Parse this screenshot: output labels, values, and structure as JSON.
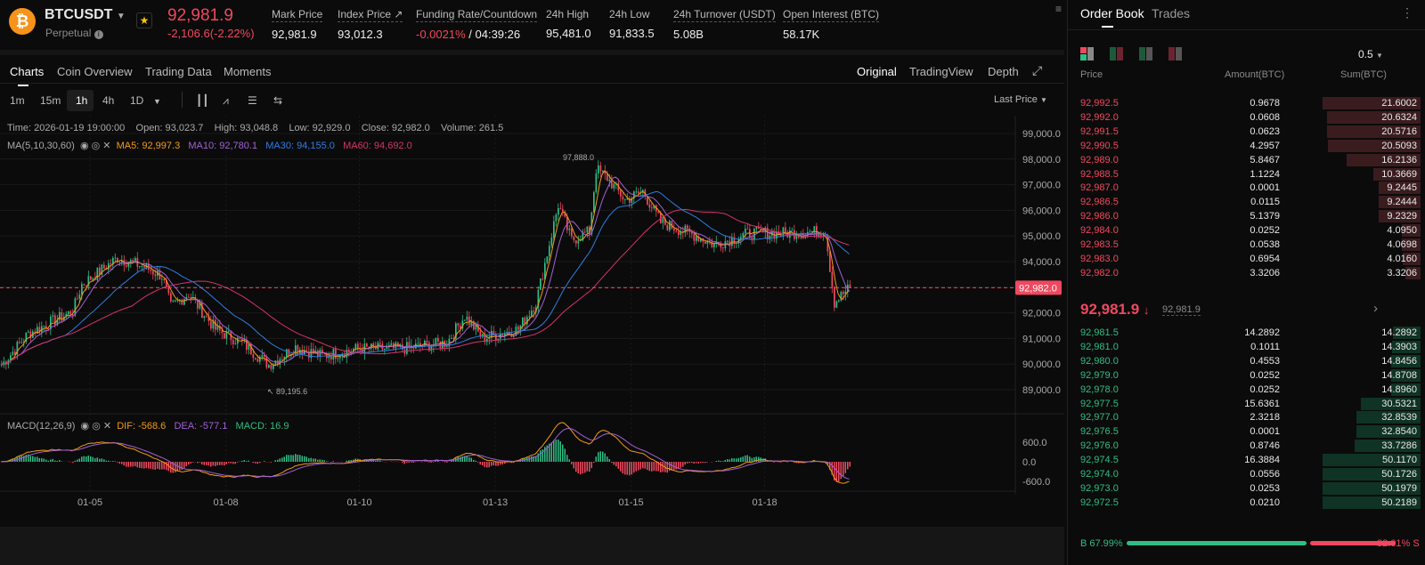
{
  "header": {
    "symbol": "BTCUSDT",
    "type": "Perpetual",
    "last_price": "92,981.9",
    "change": "-2,106.6(-2.22%)",
    "stats": [
      {
        "label": "Mark Price",
        "value": "92,981.9"
      },
      {
        "label": "Index Price ↗",
        "value": "93,012.3"
      },
      {
        "label": "Funding Rate/Countdown",
        "value": "-0.0021%",
        "value2": " / 04:39:26"
      },
      {
        "label": "24h High",
        "value": "95,481.0"
      },
      {
        "label": "24h Low",
        "value": "91,833.5"
      },
      {
        "label": "24h Turnover (USDT)",
        "value": "5.08B"
      },
      {
        "label": "Open Interest (BTC)",
        "value": "58.17K"
      }
    ]
  },
  "tabs": [
    "Charts",
    "Coin Overview",
    "Trading Data",
    "Moments"
  ],
  "chart_modes": [
    "Original",
    "TradingView",
    "Depth"
  ],
  "intervals": [
    "1m",
    "15m",
    "1h",
    "4h",
    "1D"
  ],
  "price_type": "Last Price",
  "ohlc": "Time: 2026-01-19 19:00:00    Open: 93,023.7    High: 93,048.8    Low: 92,929.0    Close: 92,982.0    Volume: 261.5",
  "ma": {
    "label": "MA(5,10,30,60)",
    "ma5": "MA5: 92,997.3",
    "ma10": "MA10: 92,780.1",
    "ma30": "MA30: 94,155.0",
    "ma60": "MA60: 94,692.0"
  },
  "macd": {
    "label": "MACD(12,26,9)",
    "dif": "DIF: -568.6",
    "dea": "DEA: -577.1",
    "macd": "MACD: 16.9"
  },
  "colors": {
    "up": "#2fbd85",
    "down": "#f0485f",
    "ma5": "#f39c12",
    "ma10": "#a260d6",
    "ma30": "#2f7de1",
    "ma60": "#d6336c"
  },
  "chart_data": {
    "type": "candlestick",
    "y_ticks": [
      "99,000.0",
      "98,000.0",
      "97,000.0",
      "96,000.0",
      "95,000.0",
      "94,000.0",
      "93,000.0",
      "92,000.0",
      "91,000.0",
      "90,000.0",
      "89,000.0"
    ],
    "ylim": [
      89000,
      99000
    ],
    "current_price_label": "92,982.0",
    "current_price": 92982,
    "high_annotation": "97,888.0",
    "low_annotation": "89,195.6",
    "x_labels": [
      {
        "label": "01-05",
        "i": 40
      },
      {
        "label": "01-08",
        "i": 101
      },
      {
        "label": "01-10",
        "i": 161
      },
      {
        "label": "01-13",
        "i": 222
      },
      {
        "label": "01-15",
        "i": 283
      },
      {
        "label": "01-18",
        "i": 343
      }
    ],
    "candles": 382,
    "path": [
      [
        0,
        89970
      ],
      [
        12,
        91190
      ],
      [
        32,
        92060
      ],
      [
        36,
        93100
      ],
      [
        52,
        94140
      ],
      [
        64,
        93800
      ],
      [
        72,
        93440
      ],
      [
        76,
        92230
      ],
      [
        84,
        92750
      ],
      [
        96,
        91360
      ],
      [
        108,
        90840
      ],
      [
        120,
        89970
      ],
      [
        132,
        90670
      ],
      [
        144,
        90320
      ],
      [
        160,
        90600
      ],
      [
        180,
        90600
      ],
      [
        200,
        90840
      ],
      [
        208,
        91880
      ],
      [
        216,
        91010
      ],
      [
        232,
        91360
      ],
      [
        240,
        92400
      ],
      [
        250,
        96220
      ],
      [
        256,
        94830
      ],
      [
        264,
        95180
      ],
      [
        267,
        97610
      ],
      [
        272,
        97260
      ],
      [
        280,
        96400
      ],
      [
        288,
        96740
      ],
      [
        296,
        95530
      ],
      [
        312,
        95000
      ],
      [
        320,
        94660
      ],
      [
        336,
        95110
      ],
      [
        352,
        95110
      ],
      [
        370,
        95180
      ],
      [
        374,
        92400
      ],
      [
        378,
        92750
      ],
      [
        381,
        92982
      ]
    ],
    "macd_ticks": [
      "600.0",
      "0.0",
      "-600.0"
    ]
  },
  "orderbook": {
    "tabs": [
      "Order Book",
      "Trades"
    ],
    "precision": "0.5",
    "headers": [
      "Price",
      "Amount(BTC)",
      "Sum(BTC)"
    ],
    "asks": [
      [
        "92,992.5",
        "0.9678",
        "21.6002"
      ],
      [
        "92,992.0",
        "0.0608",
        "20.6324"
      ],
      [
        "92,991.5",
        "0.0623",
        "20.5716"
      ],
      [
        "92,990.5",
        "4.2957",
        "20.5093"
      ],
      [
        "92,989.0",
        "5.8467",
        "16.2136"
      ],
      [
        "92,988.5",
        "1.1224",
        "10.3669"
      ],
      [
        "92,987.0",
        "0.0001",
        "9.2445"
      ],
      [
        "92,986.5",
        "0.0115",
        "9.2444"
      ],
      [
        "92,986.0",
        "5.1379",
        "9.2329"
      ],
      [
        "92,984.0",
        "0.0252",
        "4.0950"
      ],
      [
        "92,983.5",
        "0.0538",
        "4.0698"
      ],
      [
        "92,983.0",
        "0.6954",
        "4.0160"
      ],
      [
        "92,982.0",
        "3.3206",
        "3.3206"
      ]
    ],
    "mid_price": "92,981.9",
    "mark": "92,981.9",
    "bids": [
      [
        "92,981.5",
        "14.2892",
        "14.2892"
      ],
      [
        "92,981.0",
        "0.1011",
        "14.3903"
      ],
      [
        "92,980.0",
        "0.4553",
        "14.8456"
      ],
      [
        "92,979.0",
        "0.0252",
        "14.8708"
      ],
      [
        "92,978.0",
        "0.0252",
        "14.8960"
      ],
      [
        "92,977.5",
        "15.6361",
        "30.5321"
      ],
      [
        "92,977.0",
        "2.3218",
        "32.8539"
      ],
      [
        "92,976.5",
        "0.0001",
        "32.8540"
      ],
      [
        "92,976.0",
        "0.8746",
        "33.7286"
      ],
      [
        "92,974.5",
        "16.3884",
        "50.1170"
      ],
      [
        "92,974.0",
        "0.0556",
        "50.1726"
      ],
      [
        "92,973.0",
        "0.0253",
        "50.1979"
      ],
      [
        "92,972.5",
        "0.0210",
        "50.2189"
      ]
    ],
    "buy_ratio": "B 67.99%",
    "sell_ratio": "32.01% S",
    "buy_fraction": 0.6799
  }
}
